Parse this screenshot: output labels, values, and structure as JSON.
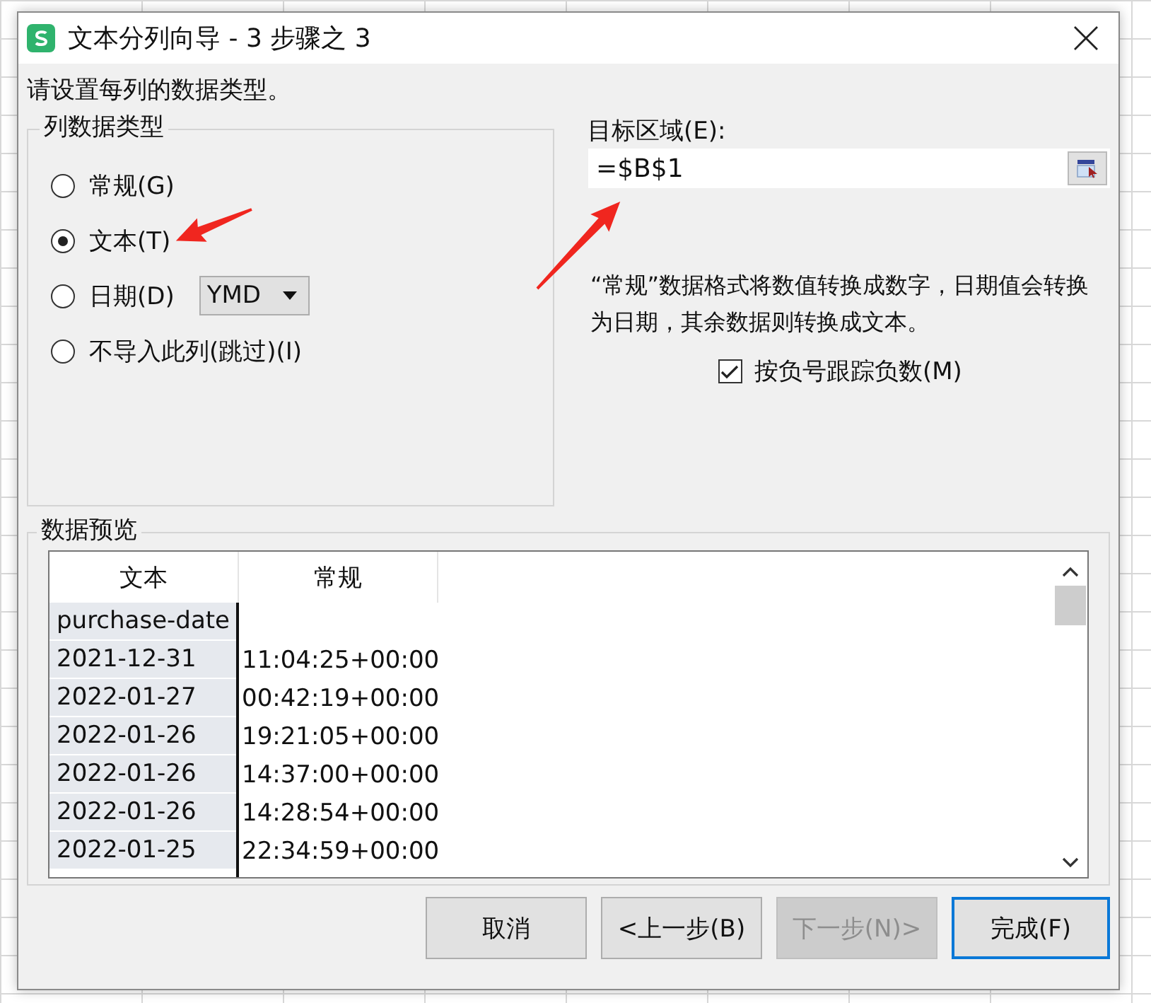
{
  "window": {
    "title": "文本分列向导 - 3 步骤之 3"
  },
  "instruction": "请设置每列的数据类型。",
  "column_type_group": {
    "title": "列数据类型",
    "options": [
      {
        "label": "常规(G)",
        "selected": false
      },
      {
        "label": "文本(T)",
        "selected": true
      },
      {
        "label": "日期(D)",
        "selected": false,
        "dropdown": "YMD"
      },
      {
        "label": "不导入此列(跳过)(I)",
        "selected": false
      }
    ]
  },
  "destination": {
    "label": "目标区域(E):",
    "value": "=$B$1"
  },
  "description": "“常规”数据格式将数值转换成数字，日期值会转换为日期，其余数据则转换成文本。",
  "negative_tracking": {
    "label": "按负号跟踪负数(M)",
    "checked": true
  },
  "preview": {
    "title": "数据预览",
    "columns": [
      "文本",
      "常规"
    ],
    "rows": [
      [
        "purchase-date"
      ],
      [
        "2021-12-31",
        "11:04:25+00:00"
      ],
      [
        "2022-01-27",
        "00:42:19+00:00"
      ],
      [
        "2022-01-26",
        "19:21:05+00:00"
      ],
      [
        "2022-01-26",
        "14:37:00+00:00"
      ],
      [
        "2022-01-26",
        "14:28:54+00:00"
      ],
      [
        "2022-01-25",
        "22:34:59+00:00"
      ]
    ]
  },
  "buttons": [
    {
      "label": "取消",
      "disabled": false,
      "default": false
    },
    {
      "label": "<上一步(B)",
      "disabled": false,
      "default": false
    },
    {
      "label": "下一步(N)>",
      "disabled": true,
      "default": false
    },
    {
      "label": "完成(F)",
      "disabled": false,
      "default": true
    }
  ]
}
